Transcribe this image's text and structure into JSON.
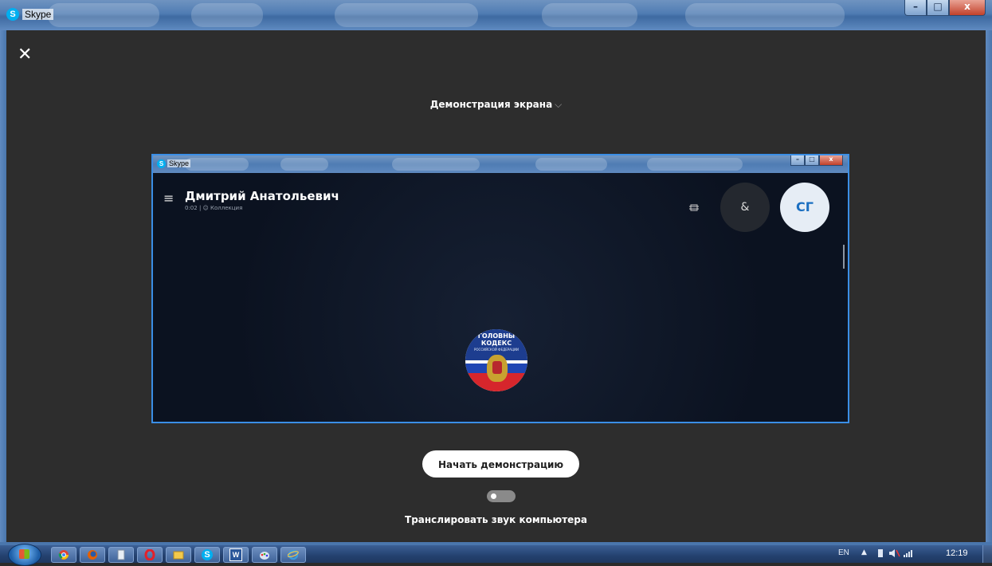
{
  "window": {
    "title": "Skype",
    "icon_letter": "S",
    "controls": {
      "minimize": "–",
      "maximize": "□",
      "close": "x"
    }
  },
  "screen_share": {
    "close_icon": "✕",
    "title": "Демонстрация экрана",
    "title_chevron": "⌵",
    "start_button": "Начать демонстрацию",
    "audio_toggle_on": false,
    "audio_label": "Транслировать звук компьютера"
  },
  "preview": {
    "window_title": "Skype",
    "icon_letter": "S",
    "menu_icon": "≡",
    "contact_name": "Дмитрий Анатольевич",
    "call_status": "0:02 | ☺ Коллекция",
    "add_person_icon": "&",
    "avatar_initials": "СГ",
    "emblem_line1": "ГОЛОВНЫ",
    "emblem_line2": "КОДЕКС",
    "emblem_line3": "РОССИЙСКОЙ ФЕДЕРАЦИИ"
  },
  "taskbar": {
    "apps": [
      "chrome-icon",
      "firefox-icon",
      "notepad-icon",
      "opera-icon",
      "explorer-icon",
      "skype-icon",
      "word-icon",
      "paint-icon",
      "ie-icon"
    ],
    "skype_letter": "S",
    "word_letter": "W",
    "language": "EN",
    "tray_arrow": "▲",
    "time": "12:19"
  }
}
